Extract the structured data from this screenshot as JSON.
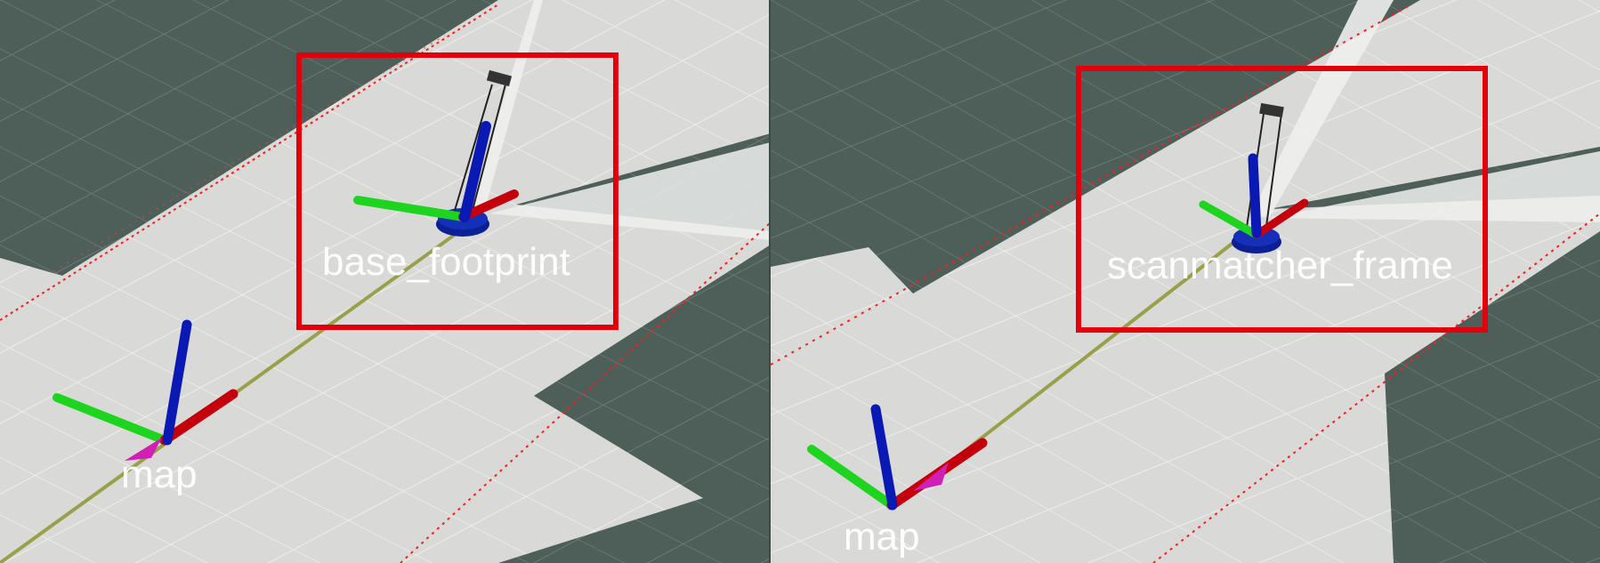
{
  "left_view": {
    "highlighted_frame_label": "base_footprint",
    "origin_frame_label": "map"
  },
  "right_view": {
    "highlighted_frame_label": "scanmatcher_frame",
    "origin_frame_label": "map"
  },
  "colors": {
    "background_grid": "#4e5f5a",
    "grid_lines": "#6f807b",
    "map_free_space": "#dadbd9",
    "highlight_box": "#e1000b",
    "axis_x": "#c4000d",
    "axis_y": "#1fd41f",
    "axis_z": "#0a18b4",
    "path_line": "#9aa04a",
    "laser_points": "#ff1a1a",
    "robot_body": "#1026a8",
    "origin_arrow": "#d11fb6"
  }
}
